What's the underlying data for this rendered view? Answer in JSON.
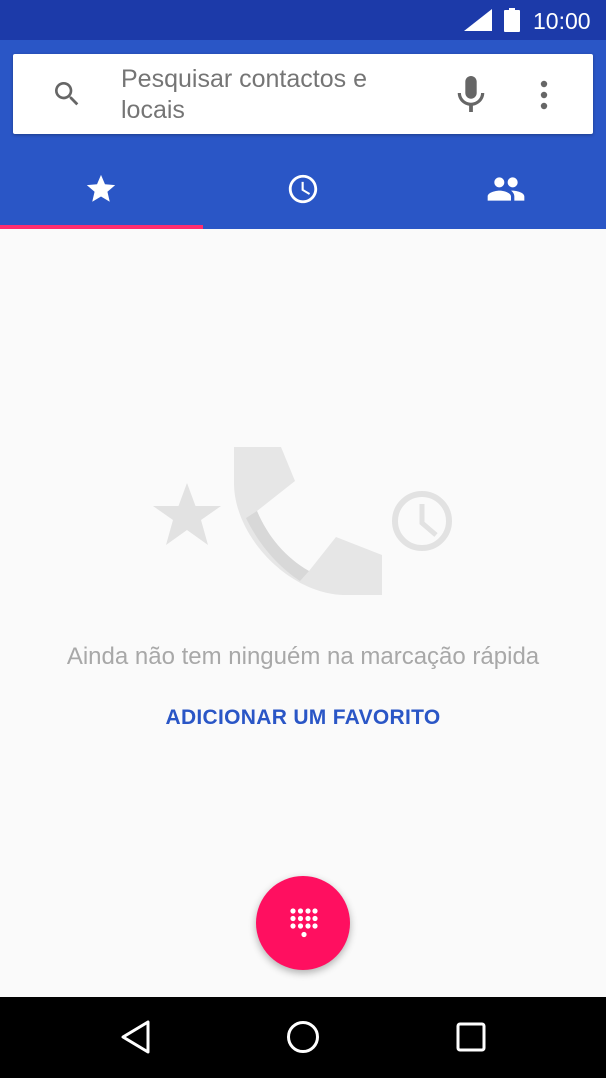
{
  "status_bar": {
    "time": "10:00",
    "icons": [
      "signal-icon",
      "battery-icon"
    ]
  },
  "search": {
    "placeholder": "Pesquisar contactos e locais",
    "icons": [
      "search-icon",
      "mic-icon",
      "more-vert-icon"
    ]
  },
  "tabs": [
    {
      "name": "favorites",
      "icon": "star-icon",
      "selected": true
    },
    {
      "name": "recents",
      "icon": "clock-icon",
      "selected": false
    },
    {
      "name": "contacts",
      "icon": "people-icon",
      "selected": false
    }
  ],
  "empty_state": {
    "message": "Ainda não tem ninguém na marcação rápida",
    "action_label": "ADICIONAR UM FAVORITO",
    "illustration_icons": [
      "star-icon",
      "phone-icon",
      "clock-icon"
    ]
  },
  "fab": {
    "icon": "dialpad-icon"
  },
  "nav_bar": {
    "buttons": [
      "back-icon",
      "home-icon",
      "recents-icon"
    ]
  },
  "colors": {
    "status_bar": "#1c3aa9",
    "header": "#2a56c6",
    "accent": "#ff0f60",
    "tab_indicator": "#ff2d6f",
    "background": "#fafafa"
  }
}
